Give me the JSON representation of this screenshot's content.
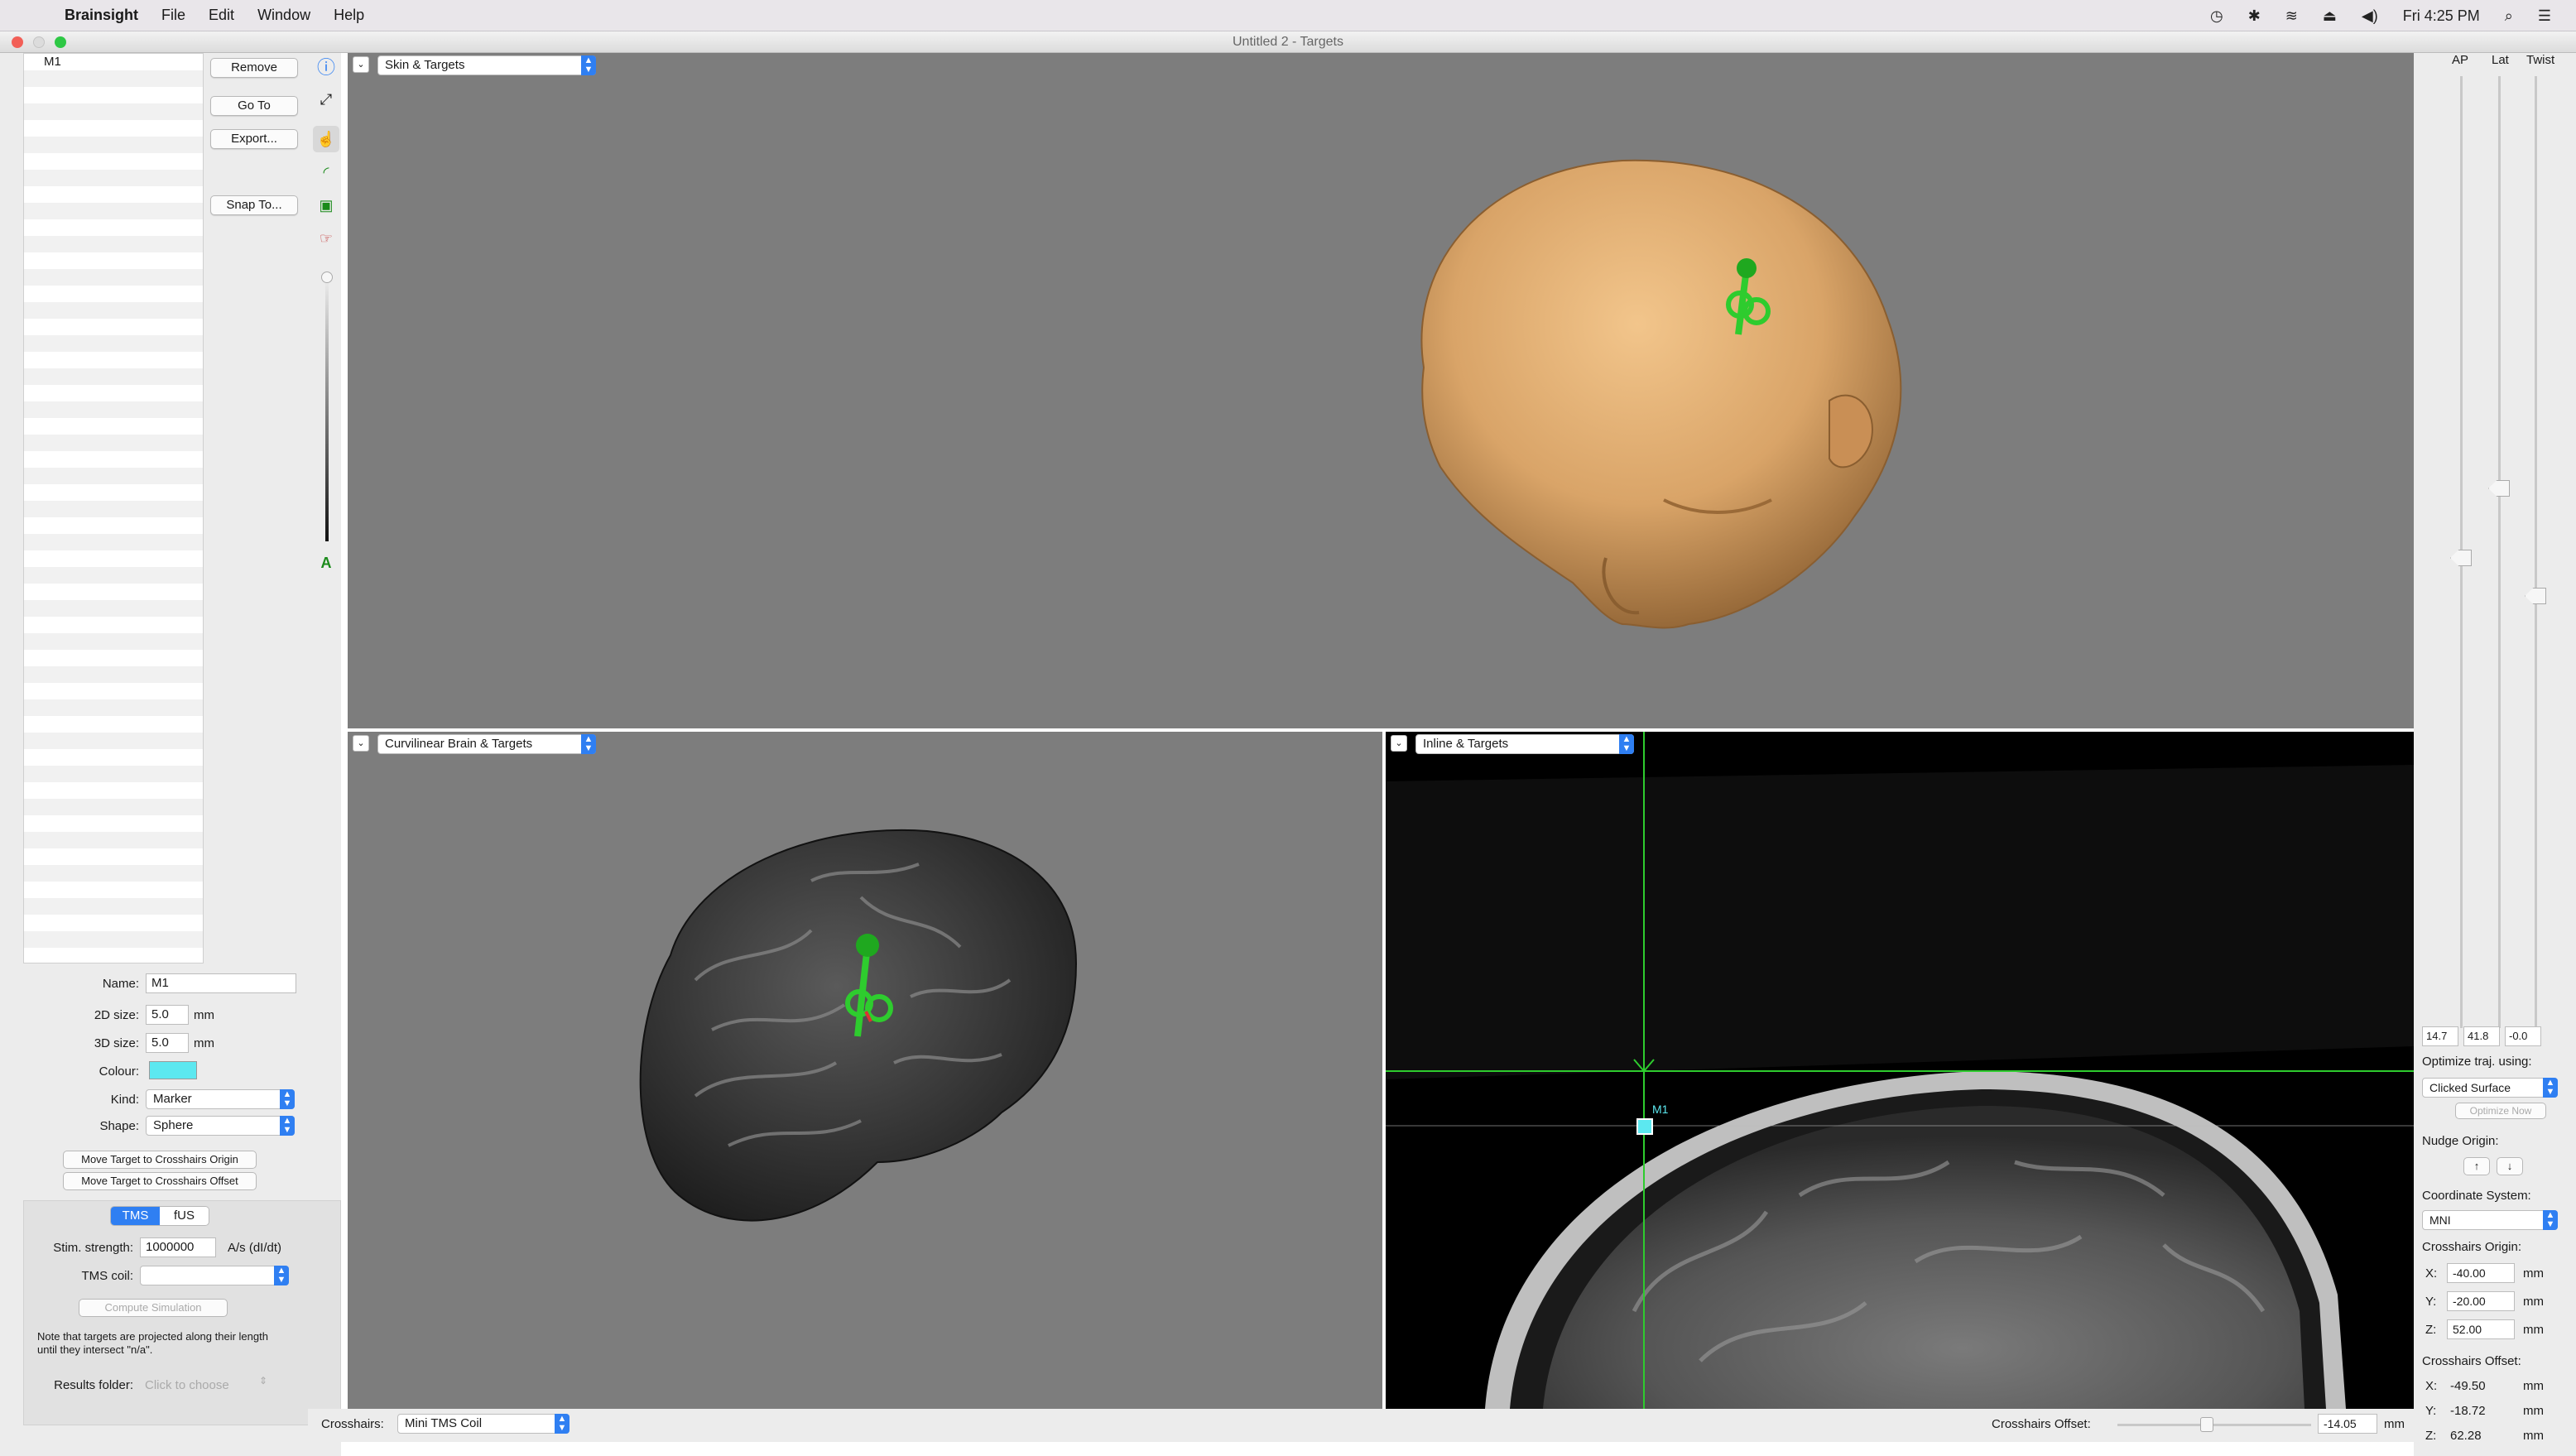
{
  "menubar": {
    "app_name": "Brainsight",
    "menus": [
      "File",
      "Edit",
      "Window",
      "Help"
    ],
    "clock": "Fri 4:25 PM"
  },
  "window": {
    "title": "Untitled 2 - Targets"
  },
  "targets": {
    "list": [
      "M1"
    ],
    "buttons": {
      "remove": "Remove",
      "go_to": "Go To",
      "export": "Export...",
      "snap_to": "Snap To..."
    }
  },
  "properties": {
    "name_label": "Name:",
    "name_value": "M1",
    "size2d_label": "2D size:",
    "size2d_value": "5.0",
    "size2d_unit": "mm",
    "size3d_label": "3D size:",
    "size3d_value": "5.0",
    "size3d_unit": "mm",
    "colour_label": "Colour:",
    "colour_value": "#5ce8f0",
    "kind_label": "Kind:",
    "kind_value": "Marker",
    "shape_label": "Shape:",
    "shape_value": "Sphere",
    "move_origin_button": "Move Target to Crosshairs Origin",
    "move_offset_button": "Move Target to Crosshairs Offset"
  },
  "modality": {
    "tabs": [
      "TMS",
      "fUS"
    ],
    "active_tab": "TMS",
    "stim_label": "Stim. strength:",
    "stim_value": "1000000",
    "stim_unit": "A/s (dI/dt)",
    "coil_label": "TMS coil:",
    "coil_value": "",
    "compute_button": "Compute Simulation",
    "note": "Note that targets are projected along their length until they intersect \"n/a\".",
    "results_label": "Results folder:",
    "results_value": "Click to choose"
  },
  "views": {
    "top": {
      "layout": "Skin & Targets"
    },
    "bottom_left": {
      "layout": "Curvilinear Brain & Targets"
    },
    "bottom_right": {
      "layout": "Inline & Targets",
      "marker_label": "M1"
    }
  },
  "trajectory": {
    "headers": [
      "AP",
      "Lat",
      "Twist"
    ],
    "values": [
      "14.7",
      "41.8",
      "-0.0"
    ],
    "optimize_label": "Optimize traj. using:",
    "optimize_value": "Clicked Surface",
    "optimize_now": "Optimize Now",
    "nudge_label": "Nudge Origin:",
    "nudge_up": "↑",
    "nudge_down": "↓",
    "coord_label": "Coordinate System:",
    "coord_value": "MNI",
    "origin_label": "Crosshairs Origin:",
    "origin": [
      {
        "axis": "X:",
        "value": "-40.00",
        "unit": "mm"
      },
      {
        "axis": "Y:",
        "value": "-20.00",
        "unit": "mm"
      },
      {
        "axis": "Z:",
        "value": "52.00",
        "unit": "mm"
      }
    ],
    "offset_label": "Crosshairs Offset:",
    "offset": [
      {
        "axis": "X:",
        "value": "-49.50",
        "unit": "mm"
      },
      {
        "axis": "Y:",
        "value": "-18.72",
        "unit": "mm"
      },
      {
        "axis": "Z:",
        "value": "62.28",
        "unit": "mm"
      }
    ]
  },
  "bottom": {
    "crosshairs_label": "Crosshairs:",
    "crosshairs_value": "Mini TMS Coil",
    "offset_label": "Crosshairs Offset:",
    "offset_value": "-14.05",
    "offset_unit": "mm"
  },
  "colors": {
    "view_bg": "#7d7d7d",
    "accent": "#2f7ff2",
    "target_green": "#2ecc2e"
  }
}
